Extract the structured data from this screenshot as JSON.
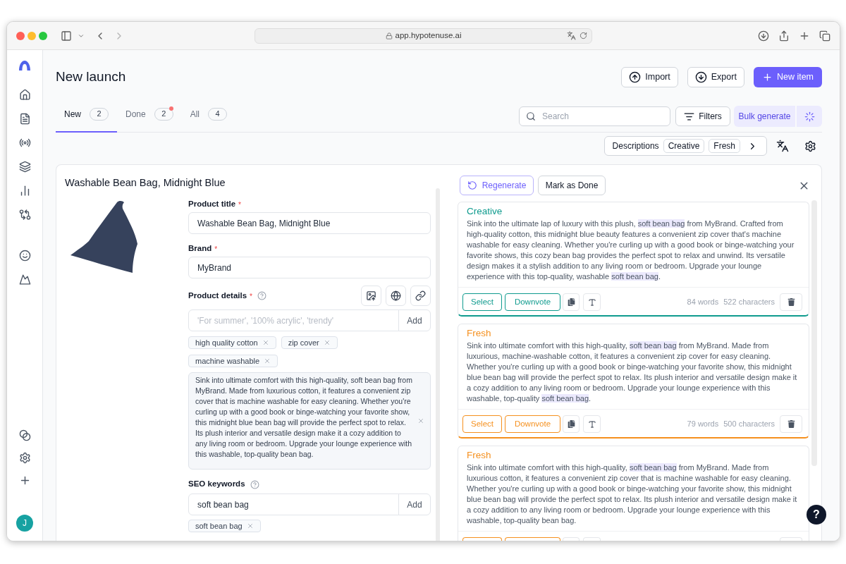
{
  "browser": {
    "url": "app.hypotenuse.ai"
  },
  "sidebar": {
    "avatar": "J"
  },
  "header": {
    "title": "New launch",
    "actions": [
      {
        "kind": "import",
        "label": "Import"
      },
      {
        "kind": "export",
        "label": "Export"
      },
      {
        "kind": "primary",
        "label": "New item"
      }
    ]
  },
  "tabs": [
    {
      "label": "New",
      "count": "2",
      "selected": true,
      "notification": false
    },
    {
      "label": "Done",
      "count": "2",
      "selected": false,
      "notification": true
    },
    {
      "label": "All",
      "count": "4",
      "selected": false,
      "notification": false
    }
  ],
  "toolbar": {
    "search": {
      "placeholder": "Search"
    },
    "filters": "Filters",
    "bulk_generate": "Bulk generate"
  },
  "output_types": {
    "label": "Descriptions",
    "chips": [
      "Creative",
      "Fresh"
    ]
  },
  "product": {
    "name": "Washable Bean Bag, Midnight Blue",
    "fields": [
      {
        "label": "Product title",
        "required_mark": "*",
        "value": "Washable Bean Bag, Midnight Blue"
      },
      {
        "label": "Brand",
        "required_mark": "*",
        "value": "MyBrand"
      }
    ],
    "details": {
      "label": "Product details",
      "required_mark": "*",
      "help": true,
      "placeholder": "'For summer', '100% acrylic', 'trendy'",
      "add": "Add",
      "tags": [
        "high quality cotton",
        "zip cover",
        "machine washable"
      ],
      "description": "Sink into ultimate comfort with this high-quality, soft bean bag from MyBrand. Made from luxurious cotton, it features a convenient zip cover that is machine washable for easy cleaning. Whether you're curling up with a good book or binge-watching your favorite show, this midnight blue bean bag will provide the perfect spot to relax. Its plush interior and versatile design make it a cozy addition to any living room or bedroom. Upgrade your lounge experience with this washable, top-quality bean bag."
    },
    "seo": {
      "label": "SEO keywords",
      "help": true,
      "value": "soft bean bag",
      "add": "Add",
      "tags": [
        "soft bean bag"
      ]
    }
  },
  "results": {
    "regenerate": "Regenerate",
    "mark_done": "Mark as Done",
    "cards": [
      {
        "style": "Creative",
        "color": "#0f9b8e",
        "text": [
          {
            "text": "Sink into the ultimate lap of luxury with this plush, ",
            "highlight": false
          },
          {
            "text": "soft bean bag",
            "highlight": true
          },
          {
            "text": " from MyBrand. Crafted from high-quality cotton, this midnight blue beauty features a convenient zip cover that's machine washable for easy cleaning. Whether you're curling up with a good book or binge-watching your favorite shows, this cozy bean bag provides the perfect spot to relax and unwind. Its versatile design makes it a stylish addition to any living room or bedroom. Upgrade your lounge experience with this top-quality, washable ",
            "highlight": false
          },
          {
            "text": "soft bean bag",
            "highlight": true
          },
          {
            "text": ".",
            "highlight": false
          }
        ],
        "select": "Select",
        "downvote": "Downvote",
        "words": "84 words",
        "characters": "522 characters"
      },
      {
        "style": "Fresh",
        "color": "#f5901e",
        "text": [
          {
            "text": "Sink into ultimate comfort with this high-quality, ",
            "highlight": false
          },
          {
            "text": "soft bean bag",
            "highlight": true
          },
          {
            "text": " from MyBrand. Made from luxurious, machine-washable cotton, it features a convenient zip cover for easy cleaning. Whether you're curling up with a good book or binge-watching your favorite show, this midnight blue bean bag will provide the perfect spot to relax. Its plush interior and versatile design make it a cozy addition to any living room or bedroom. Upgrade your lounge experience with this washable, top-quality ",
            "highlight": false
          },
          {
            "text": "soft bean bag",
            "highlight": true
          },
          {
            "text": ".",
            "highlight": false
          }
        ],
        "select": "Select",
        "downvote": "Downvote",
        "words": "79 words",
        "characters": "500 characters"
      },
      {
        "style": "Fresh",
        "color": "#f5901e",
        "text": [
          {
            "text": "Sink into ultimate comfort with this high-quality, ",
            "highlight": false
          },
          {
            "text": "soft bean bag",
            "highlight": true
          },
          {
            "text": " from MyBrand. Made from luxurious cotton, it features a convenient zip cover that is machine washable for easy cleaning. Whether you're curling up with a good book or binge-watching your favorite show, this midnight blue bean bag will provide the perfect spot to relax. Its plush interior and versatile design make it a cozy addition to any living room or bedroom. Upgrade your lounge experience with this washable, top-quality bean bag.",
            "highlight": false
          }
        ]
      }
    ]
  },
  "help": {
    "label": "?"
  }
}
